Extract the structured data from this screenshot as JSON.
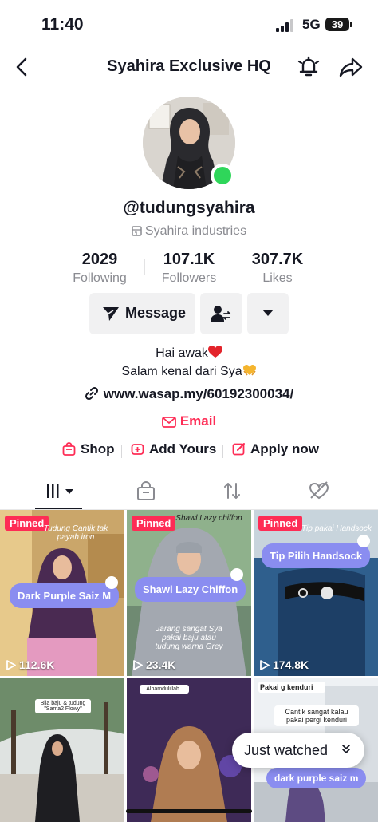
{
  "status_bar": {
    "time": "11:40",
    "network": "5G",
    "battery": "39"
  },
  "header": {
    "title": "Syahira Exclusive HQ"
  },
  "profile": {
    "username": "@tudungsyahira",
    "business_category": "Syahira industries",
    "online_color": "#2fd65a"
  },
  "stats": [
    {
      "value": "2029",
      "label": "Following"
    },
    {
      "value": "107.1K",
      "label": "Followers"
    },
    {
      "value": "307.7K",
      "label": "Likes"
    }
  ],
  "actions": {
    "message_label": "Message"
  },
  "bio": {
    "line1": "Hai awak",
    "line2": "Salam kenal dari Sya",
    "link": "www.wasap.my/60192300034/",
    "email_label": "Email"
  },
  "chips": [
    {
      "label": "Shop",
      "icon": "shopping-bag-icon"
    },
    {
      "label": "Add Yours",
      "icon": "add-yours-icon"
    },
    {
      "label": "Apply now",
      "icon": "edit-icon"
    }
  ],
  "tabs": [
    "videos-grid-icon",
    "shop-bag-icon",
    "repost-icon",
    "liked-heart-icon"
  ],
  "videos": [
    {
      "pinned": "Pinned",
      "views": "112.6K",
      "overlay": "Dark Purple Saiz M",
      "top_text": "Tudung Cantik tak payah iron"
    },
    {
      "pinned": "Pinned",
      "views": "23.4K",
      "overlay": "Shawl Lazy Chiffon",
      "top_text": "Shawl Lazy chiffon",
      "caption": "Jarang sangat Sya pakai baju atau tudung warna Grey"
    },
    {
      "pinned": "Pinned",
      "views": "174.8K",
      "overlay": "Tip Pilih Handsock",
      "top_text": "Tip pakai Handsock"
    },
    {
      "top_text": "Bila baju & tudung \"Sama2 Flowy\""
    },
    {
      "top_text": "Alhamdulillah.."
    },
    {
      "overlay": "dark purple saiz m",
      "top_text": "Pakai g kenduri",
      "caption": "Cantik sangat kalau pakai pergi kenduri"
    }
  ],
  "just_watched": {
    "label": "Just watched"
  },
  "colors": {
    "accent": "#fe2c55",
    "pill": "#8a8df0",
    "text": "#161823",
    "muted": "#8a8b91"
  }
}
